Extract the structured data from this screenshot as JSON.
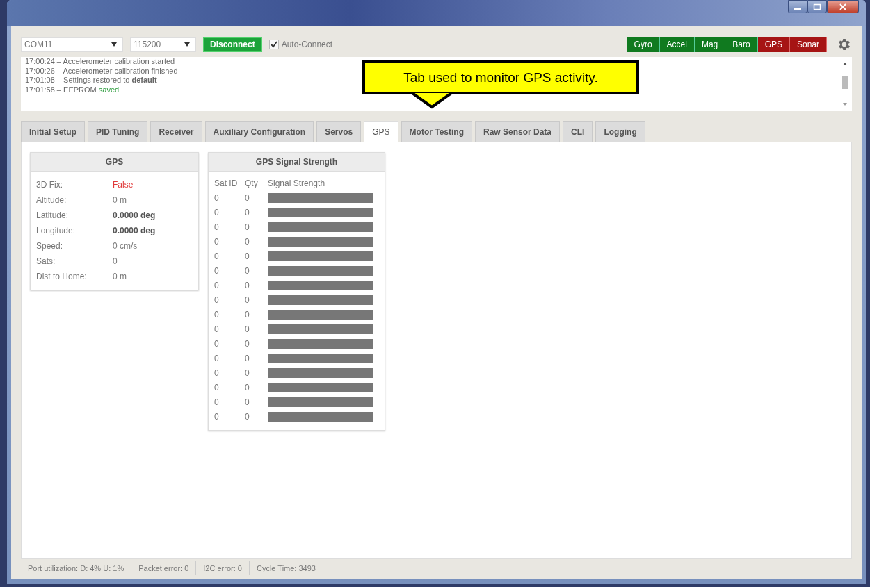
{
  "toolbar": {
    "port": "COM11",
    "baud": "115200",
    "connect_button": "Disconnect",
    "auto_connect": {
      "label": "Auto-Connect",
      "checked": true
    }
  },
  "sensors": [
    {
      "label": "Gyro",
      "on": true
    },
    {
      "label": "Accel",
      "on": true
    },
    {
      "label": "Mag",
      "on": true
    },
    {
      "label": "Baro",
      "on": true
    },
    {
      "label": "GPS",
      "on": false
    },
    {
      "label": "Sonar",
      "on": false
    }
  ],
  "log": [
    {
      "text": "17:00:24 – Accelerometer calibration started"
    },
    {
      "text": "17:00:26 – Accelerometer calibration finished"
    },
    {
      "text": "17:01:08 – Settings restored to **default**"
    },
    {
      "text": "17:01:58 – EEPROM",
      "status": "saved"
    }
  ],
  "callout": "Tab used to monitor GPS activity.",
  "tabs": [
    {
      "label": "Initial Setup",
      "selected": false
    },
    {
      "label": "PID Tuning",
      "selected": false
    },
    {
      "label": "Receiver",
      "selected": false
    },
    {
      "label": "Auxiliary Configuration",
      "selected": false
    },
    {
      "label": "Servos",
      "selected": false
    },
    {
      "label": "GPS",
      "selected": true
    },
    {
      "label": "Motor Testing",
      "selected": false
    },
    {
      "label": "Raw Sensor Data",
      "selected": false
    },
    {
      "label": "CLI",
      "selected": false
    },
    {
      "label": "Logging",
      "selected": false
    }
  ],
  "gps_panel": {
    "title": "GPS",
    "rows": [
      {
        "label": "3D Fix:",
        "value": "False",
        "kind": "alert"
      },
      {
        "label": "Altitude:",
        "value": "0 m",
        "kind": "plain"
      },
      {
        "label": "Latitude:",
        "value": "0.0000 deg",
        "kind": "bold"
      },
      {
        "label": "Longitude:",
        "value": "0.0000 deg",
        "kind": "bold"
      },
      {
        "label": "Speed:",
        "value": "0 cm/s",
        "kind": "plain"
      },
      {
        "label": "Sats:",
        "value": "0",
        "kind": "plain"
      },
      {
        "label": "Dist to Home:",
        "value": "0 m",
        "kind": "plain"
      }
    ]
  },
  "signal_panel": {
    "title": "GPS Signal Strength",
    "columns": [
      "Sat ID",
      "Qty",
      "Signal Strength"
    ],
    "rows": [
      {
        "sat_id": "0",
        "qty": "0"
      },
      {
        "sat_id": "0",
        "qty": "0"
      },
      {
        "sat_id": "0",
        "qty": "0"
      },
      {
        "sat_id": "0",
        "qty": "0"
      },
      {
        "sat_id": "0",
        "qty": "0"
      },
      {
        "sat_id": "0",
        "qty": "0"
      },
      {
        "sat_id": "0",
        "qty": "0"
      },
      {
        "sat_id": "0",
        "qty": "0"
      },
      {
        "sat_id": "0",
        "qty": "0"
      },
      {
        "sat_id": "0",
        "qty": "0"
      },
      {
        "sat_id": "0",
        "qty": "0"
      },
      {
        "sat_id": "0",
        "qty": "0"
      },
      {
        "sat_id": "0",
        "qty": "0"
      },
      {
        "sat_id": "0",
        "qty": "0"
      },
      {
        "sat_id": "0",
        "qty": "0"
      },
      {
        "sat_id": "0",
        "qty": "0"
      }
    ]
  },
  "status_bar": [
    "Port utilization: D: 4% U: 1%",
    "Packet error: 0",
    "I2C error: 0",
    "Cycle Time: 3493"
  ]
}
